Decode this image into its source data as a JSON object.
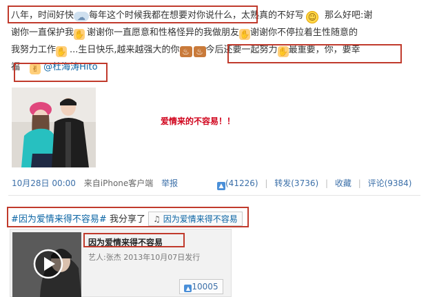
{
  "post": {
    "line1_a": "八年，时间好快",
    "line1_b": "每年这个时候我都在想要对你说什么，",
    "line1_c": "太熟真的不好写",
    "line1_d": "那么好吧:谢",
    "line2_a": "谢你一直保护我",
    "line2_b": "谢谢你一直愿意和性格怪异的我做朋友",
    "line2_c": "谢谢你不停拉着生性随意的",
    "line3_a": "我努力工作",
    "line3_b": "...生日快乐,越来越强大的你",
    "line3_c": "今后还要一起努力",
    "line3_d": "最重要，你，要幸",
    "line4_a": "福",
    "mention": "@杜海涛Hito",
    "side_caption": "爱情来的不容易！！",
    "emoji_cloud": "☁",
    "emoji_grin": "☺",
    "emoji_hand": "✋",
    "emoji_cake": "♨",
    "emoji_victory": "✌"
  },
  "meta": {
    "time": "10月28日 00:00",
    "source": "来自iPhone客户端",
    "report": "举报",
    "like": "(41226)",
    "repost": "转发(3736)",
    "favorite": "收藏",
    "comment": "评论(9384)"
  },
  "share": {
    "hashtag": "#因为爱情来得不容易#",
    "shared_text": "我分享了",
    "music_icon": "♫",
    "music_title": "因为爱情来得不容易"
  },
  "card": {
    "title": "因为爱情来得不容易",
    "subtitle": "艺人:张杰 2013年10月07日发行",
    "likes": "10005"
  },
  "colors": {
    "accent": "#c0392b",
    "link": "#0a64a4",
    "caption_red": "#d0021b"
  }
}
